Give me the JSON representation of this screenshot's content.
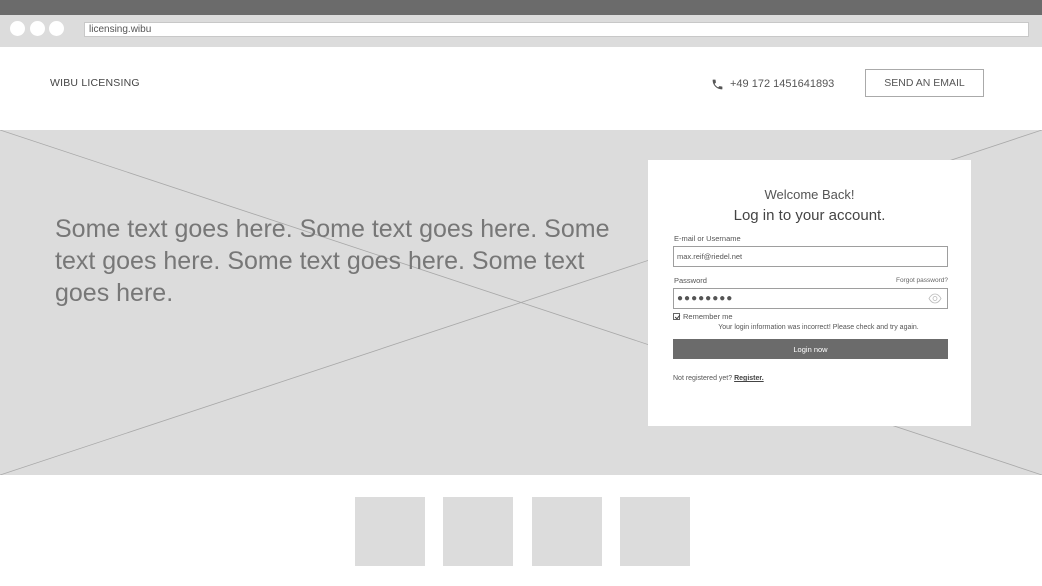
{
  "browser": {
    "url": "licensing.wibu"
  },
  "header": {
    "brand": "WIBU LICENSING",
    "phone": "+49 172 1451641893",
    "email_button": "SEND AN EMAIL"
  },
  "hero": {
    "text": "Some text goes here. Some text goes here. Some text goes here. Some text goes here. Some text goes here."
  },
  "login": {
    "welcome": "Welcome Back!",
    "title": "Log in to your account.",
    "email_label": "E-mail or Username",
    "email_value": "max.reif@riedel.net",
    "password_label": "Password",
    "forgot_link": "Forgot password?",
    "password_mask": "●●●●●●●●",
    "remember_label": "Remember me",
    "remember_checked": true,
    "error_message": "Your login information was incorrect! Please check and try again.",
    "login_button": "Login now",
    "register_prompt": "Not registered yet?",
    "register_link": "Register."
  },
  "colors": {
    "chrome_dark": "#6b6b6b",
    "placeholder_gray": "#dcdcdc",
    "button_dark": "#6b6b6b"
  },
  "icons": {
    "phone": "phone-icon",
    "password_visibility": "eye-icon"
  }
}
